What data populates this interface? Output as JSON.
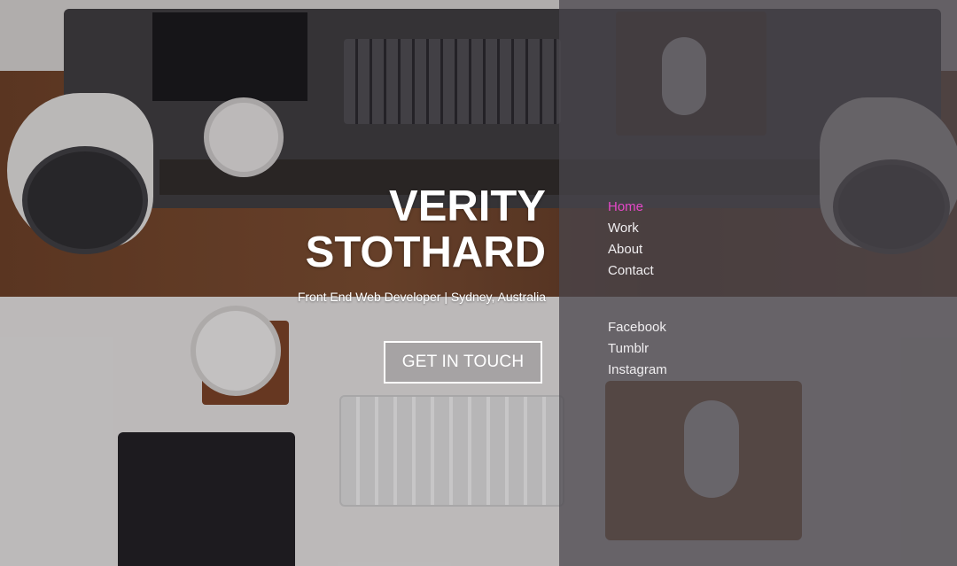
{
  "hero": {
    "title_line1": "VERITY",
    "title_line2": "STOTHARD",
    "subtitle": "Front End Web Developer | Sydney, Australia",
    "cta_label": "GET IN TOUCH"
  },
  "nav": {
    "items": [
      {
        "label": "Home",
        "active": true
      },
      {
        "label": "Work",
        "active": false
      },
      {
        "label": "About",
        "active": false
      },
      {
        "label": "Contact",
        "active": false
      }
    ]
  },
  "social": {
    "items": [
      {
        "label": "Facebook"
      },
      {
        "label": "Tumblr"
      },
      {
        "label": "Instagram"
      }
    ]
  },
  "colors": {
    "active_link": "#e548c8",
    "panel_overlay": "#464248"
  }
}
